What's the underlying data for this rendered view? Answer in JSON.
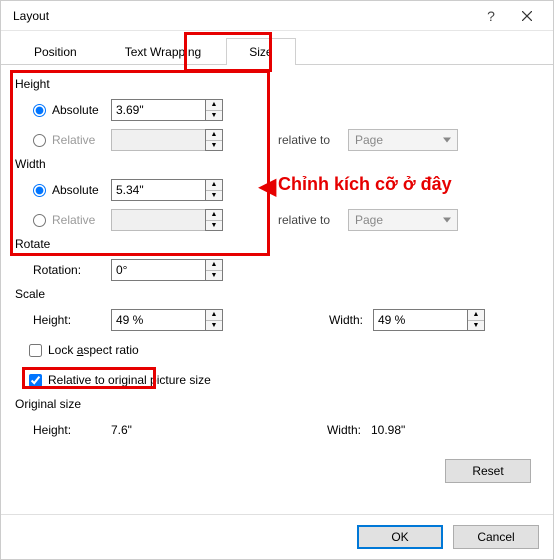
{
  "title": "Layout",
  "tabs": {
    "position": "Position",
    "textwrap": "Text Wrapping",
    "size": "Size"
  },
  "height": {
    "label": "Height",
    "absolute": "Absolute",
    "absolute_val": "3.69\"",
    "relative": "Relative",
    "relative_val": "",
    "relativeto": "relative to",
    "page": "Page"
  },
  "width": {
    "label": "Width",
    "absolute": "Absolute",
    "absolute_val": "5.34\"",
    "relative": "Relative",
    "relative_val": "",
    "relativeto": "relative to",
    "page": "Page"
  },
  "rotate": {
    "label": "Rotate",
    "rotation": "Rotation:",
    "rotation_val": "0°"
  },
  "scale": {
    "label": "Scale",
    "height": "Height:",
    "height_val": "49 %",
    "width": "Width:",
    "width_val": "49 %",
    "lock": "Lock aspect ratio",
    "relative_orig": "Relative to original picture size"
  },
  "original": {
    "label": "Original size",
    "height": "Height:",
    "height_val": "7.6\"",
    "width": "Width:",
    "width_val": "10.98\""
  },
  "buttons": {
    "reset": "Reset",
    "ok": "OK",
    "cancel": "Cancel"
  },
  "annotation": "Chỉnh kích cỡ ở đây"
}
